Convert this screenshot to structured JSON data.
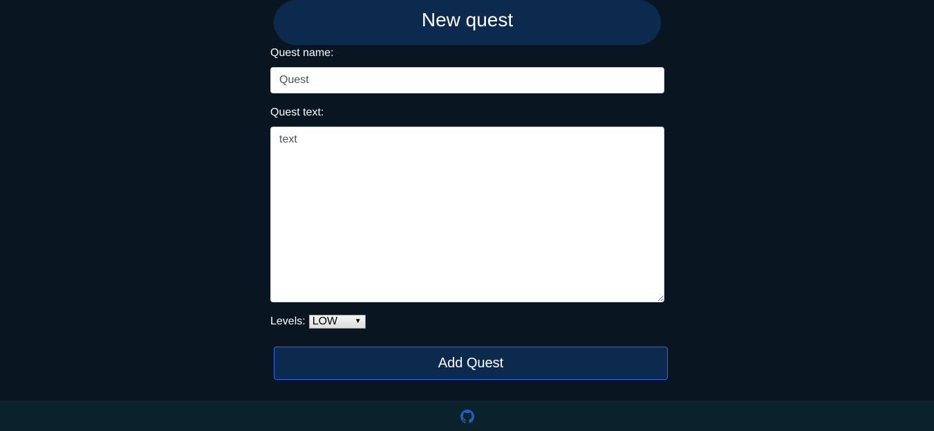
{
  "header": {
    "title": "New quest"
  },
  "form": {
    "name_label": "Quest name:",
    "name_value": "Quest",
    "text_label": "Quest text:",
    "text_value": "text",
    "levels_label": "Levels:",
    "levels_selected": "LOW",
    "submit_label": "Add Quest"
  },
  "footer": {
    "icon": "github-icon",
    "icon_color": "#1f5fbf"
  },
  "colors": {
    "background": "#0a1522",
    "panel": "#0c2a4d",
    "button_border": "#1f6fe0",
    "footer_bg": "#0b212b"
  }
}
